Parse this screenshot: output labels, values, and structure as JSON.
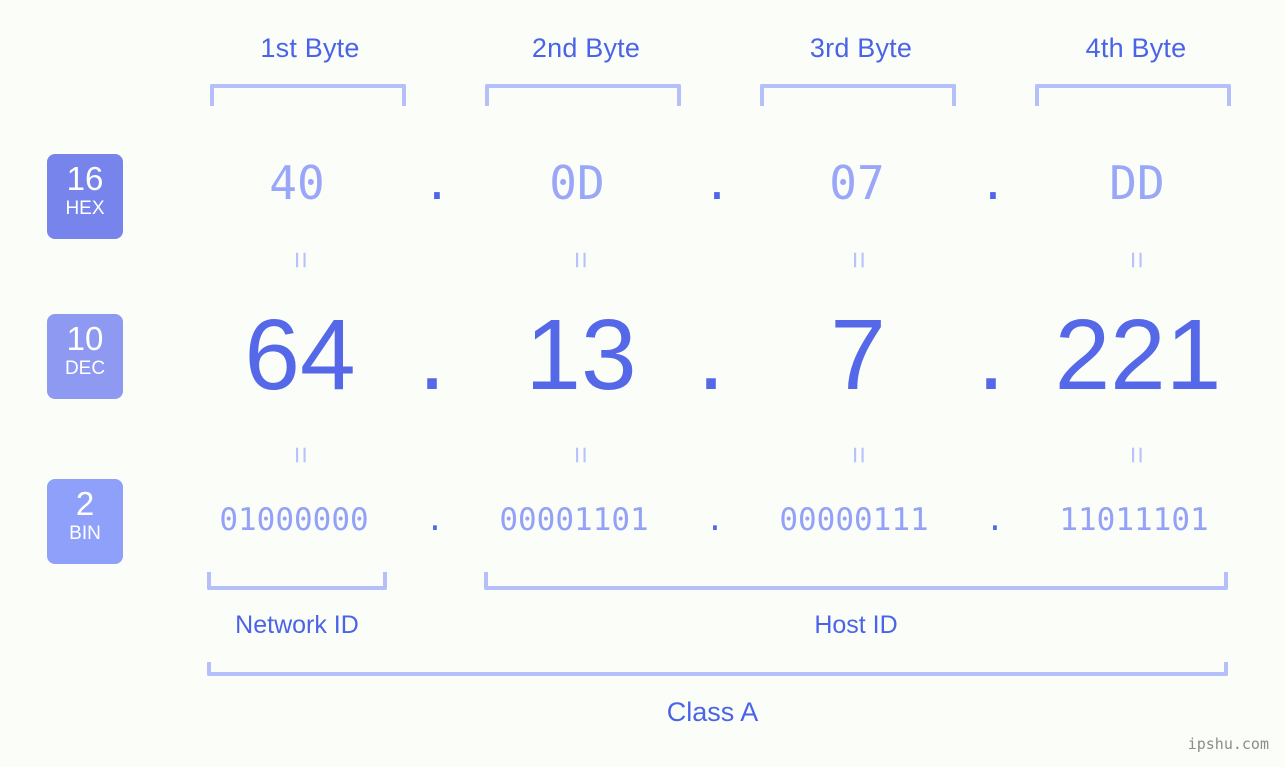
{
  "watermark": "ipshu.com",
  "colors": {
    "background": "#fbfdf8",
    "accent_strong": "#4a64e8",
    "accent_dec": "#5568e8",
    "accent_light": "#9aa6f7",
    "bracket": "#b5c0fb",
    "badge_hex": "#7684ec",
    "badge_dec": "#8e9af2",
    "badge_bin": "#8fa0fb"
  },
  "headers": [
    {
      "label": "1st Byte"
    },
    {
      "label": "2nd Byte"
    },
    {
      "label": "3rd Byte"
    },
    {
      "label": "4th Byte"
    }
  ],
  "bases": [
    {
      "number": "16",
      "name": "HEX"
    },
    {
      "number": "10",
      "name": "DEC"
    },
    {
      "number": "2",
      "name": "BIN"
    }
  ],
  "separator": ".",
  "equals": "=",
  "rows": {
    "hex": {
      "base": "16",
      "name": "HEX",
      "values": [
        "40",
        "0D",
        "07",
        "DD"
      ]
    },
    "dec": {
      "base": "10",
      "name": "DEC",
      "values": [
        "64",
        "13",
        "7",
        "221"
      ]
    },
    "bin": {
      "base": "2",
      "name": "BIN",
      "values": [
        "01000000",
        "00001101",
        "00000111",
        "11011101"
      ]
    }
  },
  "segments": {
    "network_id": "Network ID",
    "host_id": "Host ID"
  },
  "class": {
    "label": "Class A"
  }
}
